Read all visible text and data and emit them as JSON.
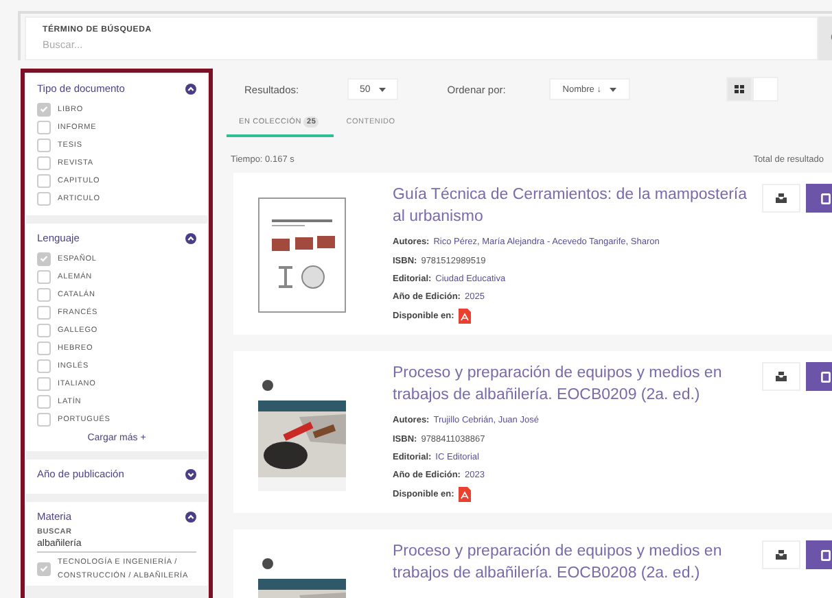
{
  "search": {
    "label": "TÉRMINO DE BÚSQUEDA",
    "placeholder": "Buscar..."
  },
  "filters": [
    {
      "title": "Tipo de documento",
      "expanded": true,
      "options": [
        {
          "label": "LIBRO",
          "checked": true
        },
        {
          "label": "INFORME",
          "checked": false
        },
        {
          "label": "TESIS",
          "checked": false
        },
        {
          "label": "REVISTA",
          "checked": false
        },
        {
          "label": "CAPITULO",
          "checked": false
        },
        {
          "label": "ARTICULO",
          "checked": false
        }
      ]
    },
    {
      "title": "Lenguaje",
      "expanded": true,
      "options": [
        {
          "label": "ESPAÑOL",
          "checked": true
        },
        {
          "label": "ALEMÁN",
          "checked": false
        },
        {
          "label": "CATALÁN",
          "checked": false
        },
        {
          "label": "FRANCÉS",
          "checked": false
        },
        {
          "label": "GALLEGO",
          "checked": false
        },
        {
          "label": "HEBREO",
          "checked": false
        },
        {
          "label": "INGLÉS",
          "checked": false
        },
        {
          "label": "ITALIANO",
          "checked": false
        },
        {
          "label": "LATÍN",
          "checked": false
        },
        {
          "label": "PORTUGUÉS",
          "checked": false
        }
      ],
      "more": "Cargar más +"
    },
    {
      "title": "Año de publicación",
      "expanded": false
    },
    {
      "title": "Materia",
      "expanded": true,
      "search_label": "BUSCAR",
      "search_value": "albañilería",
      "options": [
        {
          "label": "TECNOLOGÍA E INGENIERÍA / CONSTRUCCIÓN / ALBAÑILERÍA",
          "checked": true
        }
      ]
    }
  ],
  "toolbar": {
    "results_label": "Resultados:",
    "page_size": "50",
    "sort_label": "Ordenar por:",
    "sort_value": "Nombre ↓"
  },
  "tabs": [
    {
      "label": "EN COLECCIÓN",
      "count": "25",
      "selected": true
    },
    {
      "label": "CONTENIDO",
      "selected": false
    }
  ],
  "time": "Tiempo: 0.167 s",
  "total": "Total de resultado",
  "books": [
    {
      "title": "Guía Técnica de Cerramientos: de la mampostería al urbanismo",
      "cover": {
        "kind": "picture"
      },
      "fields": [
        {
          "label": "Autores:",
          "value": "Rico Pérez, María Alejandra - Acevedo Tangarife, Sharon",
          "kind": "link"
        },
        {
          "label": "ISBN:",
          "value": "9781512989519",
          "kind": "text"
        },
        {
          "label": "Editorial:",
          "value": "Ciudad Educativa",
          "kind": "link"
        },
        {
          "label": "Año de Edición:",
          "value": "2025",
          "kind": "link"
        },
        {
          "label": "Disponible en:",
          "kind": "pdf"
        }
      ]
    },
    {
      "title": "Proceso y preparación de equipos y medios en trabajos de albañilería. EOCB0209 (2a. ed.)",
      "cover": {
        "kind": "picture"
      },
      "fields": [
        {
          "label": "Autores:",
          "value": "Trujillo Cebrián, Juan José",
          "kind": "link"
        },
        {
          "label": "ISBN:",
          "value": "9788411038867",
          "kind": "text"
        },
        {
          "label": "Editorial:",
          "value": "IC Editorial",
          "kind": "link"
        },
        {
          "label": "Año de Edición:",
          "value": "2023",
          "kind": "link"
        },
        {
          "label": "Disponible en:",
          "kind": "pdf"
        }
      ]
    },
    {
      "title": "Proceso y preparación de equipos y medios en trabajos de albañilería. EOCB0208 (2a. ed.)",
      "cover": {
        "kind": "picture"
      }
    }
  ]
}
